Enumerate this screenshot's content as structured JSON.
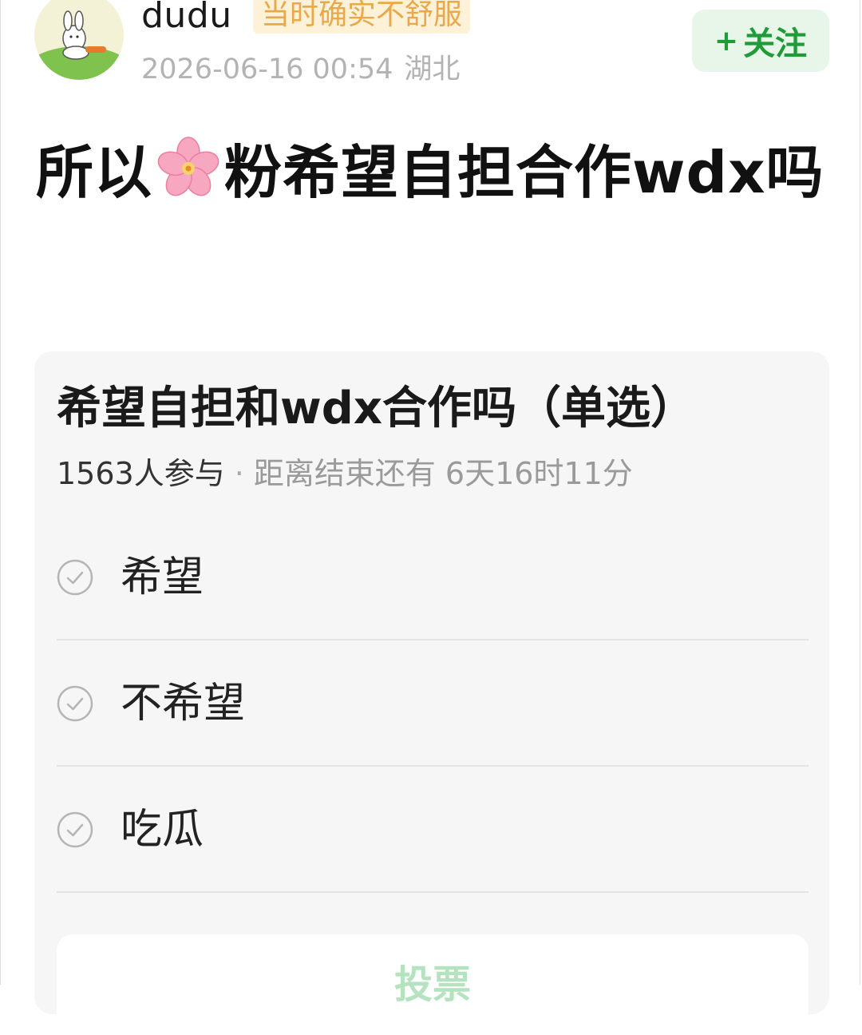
{
  "header": {
    "username": "dudu",
    "mood_tag": "当时确实不舒服",
    "timestamp": "2026-06-16 00:54",
    "location": "湖北",
    "follow_plus": "+",
    "follow_label": "关注",
    "avatar_icon": "bunny-avatar-icon"
  },
  "post": {
    "title_before_emoji": "所以",
    "title_after_emoji": "粉希望自担合作wdx吗",
    "emoji": "cherry-blossom-icon"
  },
  "poll": {
    "question": "希望自担和wdx合作吗（单选）",
    "participants": "1563人参与",
    "separator": "·",
    "remaining": "距离结束还有 6天16时11分",
    "options": [
      {
        "label": "希望"
      },
      {
        "label": "不希望"
      },
      {
        "label": "吃瓜"
      }
    ],
    "vote_label": "投票"
  },
  "colors": {
    "accent_green": "#1f9c38",
    "follow_bg": "#e8f6ea",
    "mood_tag_text": "#e9a94a",
    "mood_tag_bg": "#fdf1d7",
    "card_bg": "#f6f6f6"
  }
}
